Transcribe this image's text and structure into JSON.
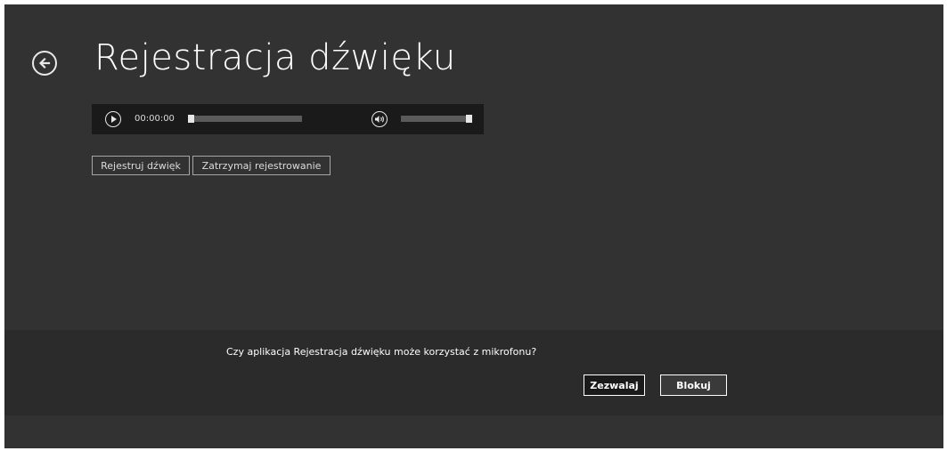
{
  "app": {
    "title": "Rejestracja dźwięku"
  },
  "player": {
    "time": "00:00:00",
    "seek_progress": 0.0,
    "volume_level": 1.0
  },
  "buttons": {
    "record_label": "Rejestruj dźwięk",
    "stop_label": "Zatrzymaj rejestrowanie"
  },
  "dialog": {
    "message": "Czy aplikacja Rejestracja dźwięku może korzystać z mikrofonu?",
    "allow_label": "Zezwalaj",
    "block_label": "Blokuj"
  },
  "icons": {
    "back": "back-arrow-icon",
    "play": "play-icon",
    "volume": "volume-icon"
  },
  "colors": {
    "background": "#323232",
    "player_bar": "#1a1a1a",
    "dialog_bg": "#2b2b2b",
    "text": "#ffffff"
  }
}
